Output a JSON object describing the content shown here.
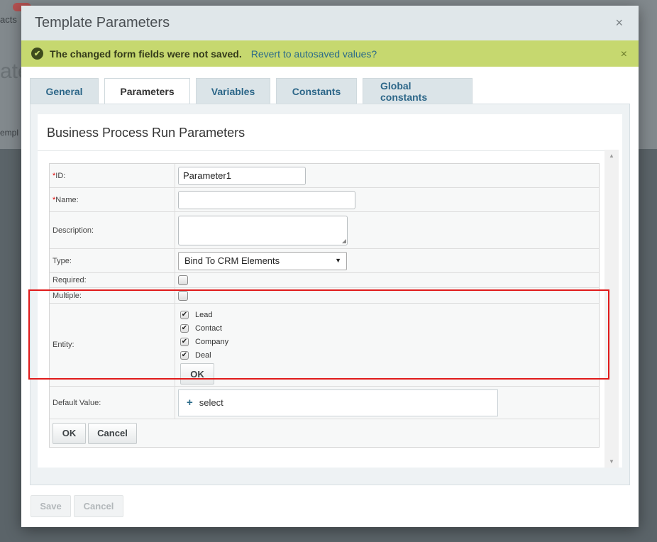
{
  "background": {
    "crumb_text": "acts",
    "heading_text": "ate",
    "sub_text": "empl"
  },
  "dialog": {
    "title": "Template Parameters",
    "close_glyph": "×"
  },
  "notice": {
    "icon": "check-circle-icon",
    "check_glyph": "✔",
    "message": "The changed form fields were not saved.",
    "link": "Revert to autosaved values?",
    "close_glyph": "×",
    "color": "#c6d86f"
  },
  "tabs": [
    {
      "label": "General",
      "active": false
    },
    {
      "label": "Parameters",
      "active": true
    },
    {
      "label": "Variables",
      "active": false
    },
    {
      "label": "Constants",
      "active": false
    },
    {
      "label": "Global constants",
      "active": false
    }
  ],
  "panel": {
    "title": "Business Process Run Parameters"
  },
  "form": {
    "required_mark": "*",
    "id": {
      "label": "ID:",
      "value": "Parameter1"
    },
    "name": {
      "label": "Name:",
      "value": ""
    },
    "description": {
      "label": "Description:",
      "value": ""
    },
    "type": {
      "label": "Type:",
      "value": "Bind To CRM Elements",
      "arrow": "▼"
    },
    "required": {
      "label": "Required:",
      "checked": false
    },
    "multiple": {
      "label": "Multiple:",
      "checked": false
    },
    "entity": {
      "label": "Entity:",
      "check_glyph": "✔",
      "options": [
        {
          "label": "Lead",
          "checked": true
        },
        {
          "label": "Contact",
          "checked": true
        },
        {
          "label": "Company",
          "checked": true
        },
        {
          "label": "Deal",
          "checked": true
        }
      ],
      "ok_label": "OK"
    },
    "default_value": {
      "label": "Default Value:",
      "plus": "+",
      "select_label": "select"
    },
    "ok_label": "OK",
    "cancel_label": "Cancel"
  },
  "scroll": {
    "up": "▲",
    "down": "▼"
  },
  "footer": {
    "save_label": "Save",
    "cancel_label": "Cancel"
  },
  "highlight_color": "#e01a1a"
}
